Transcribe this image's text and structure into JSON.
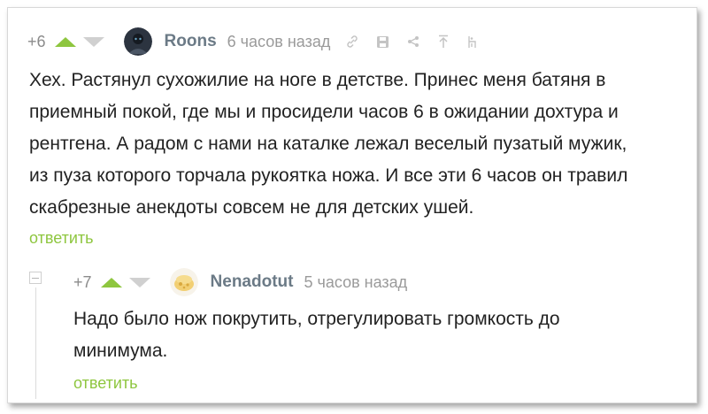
{
  "comments": [
    {
      "rating": "+6",
      "username": "Roons",
      "time": "6 часов назад",
      "lines": [
        "Хех. Растянул сухожилие на ноге в детстве. Принес меня батяня в",
        "приемный покой, где мы и просидели часов 6 в ожидании дохтура и",
        "рентгена. А радом с нами на каталке лежал веселый пузатый мужик,",
        "из пуза которого торчала рукоятка ножа. И все эти 6 часов он травил",
        "скабрезные анекдоты совсем не для детских ушей."
      ],
      "reply": "ответить",
      "icons": [
        "link-icon",
        "save-icon",
        "share-icon",
        "scroll-up-icon",
        "report-icon"
      ]
    },
    {
      "rating": "+7",
      "username": "Nenadotut",
      "time": "5 часов назад",
      "lines": [
        "Надо было нож покрутить, отрегулировать громкость до",
        "минимума."
      ],
      "reply": "ответить"
    }
  ],
  "colors": {
    "accent_green": "#8ec63f",
    "username": "#6b7a86",
    "muted": "#9a9a9a",
    "text": "#222222"
  }
}
